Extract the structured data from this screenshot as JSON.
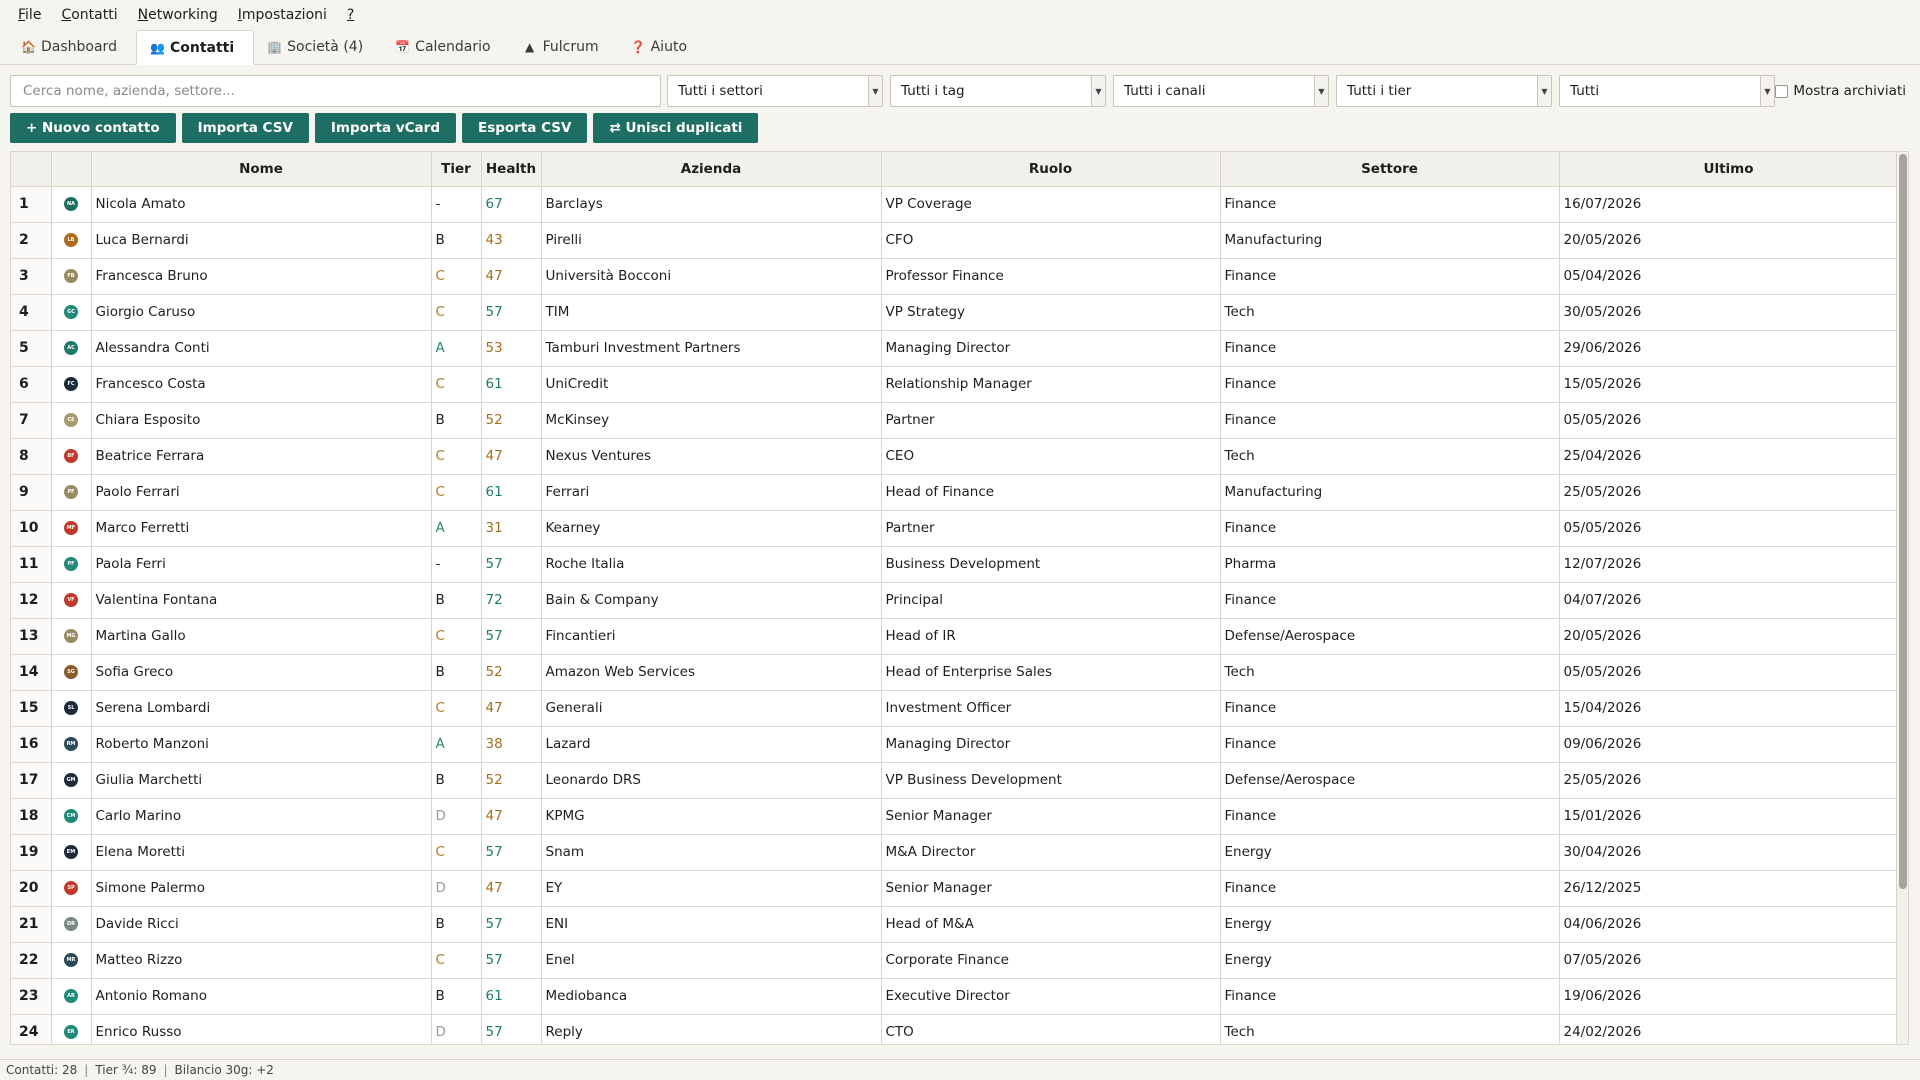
{
  "menu": [
    {
      "u": "F",
      "rest": "ile"
    },
    {
      "u": "C",
      "rest": "ontatti"
    },
    {
      "u": "N",
      "rest": "etworking"
    },
    {
      "u": "I",
      "rest": "mpostazioni"
    },
    {
      "u": "?",
      "rest": ""
    }
  ],
  "tabs": [
    {
      "icon": "🏠",
      "label": "Dashboard",
      "active": false,
      "name": "tab-dashboard"
    },
    {
      "icon": "👥",
      "label": "Contatti",
      "active": true,
      "name": "tab-contatti"
    },
    {
      "icon": "🏢",
      "label": "Società (4)",
      "active": false,
      "name": "tab-societa"
    },
    {
      "icon": "📅",
      "label": "Calendario",
      "active": false,
      "name": "tab-calendario"
    },
    {
      "icon": "▲",
      "label": "Fulcrum",
      "active": false,
      "name": "tab-fulcrum"
    },
    {
      "icon": "❓",
      "label": "Aiuto",
      "active": false,
      "name": "tab-aiuto"
    }
  ],
  "filters": {
    "search_placeholder": "Cerca nome, azienda, settore...",
    "settori": "Tutti i settori",
    "tag": "Tutti i tag",
    "canali": "Tutti i canali",
    "tier": "Tutti i tier",
    "stato": "Tutti",
    "archived_label": "Mostra archiviati"
  },
  "actions": {
    "new": "+ Nuovo contatto",
    "import_csv": "Importa CSV",
    "import_vcard": "Importa vCard",
    "export_csv": "Esporta CSV",
    "merge": "⇄ Unisci duplicati"
  },
  "table": {
    "columns": [
      "",
      "",
      "Nome",
      "Tier",
      "Health",
      "Azienda",
      "Ruolo",
      "Settore",
      "Ultimo"
    ],
    "rows": [
      {
        "n": "1",
        "ini": "NA",
        "color": "#1f6e63",
        "name": "Nicola Amato",
        "tier": "-",
        "health": "67",
        "company": "Barclays",
        "role": "VP Coverage",
        "sector": "Finance",
        "last": "16/07/2026"
      },
      {
        "n": "2",
        "ini": "LB",
        "color": "#b06a1e",
        "name": "Luca Bernardi",
        "tier": "B",
        "health": "43",
        "company": "Pirelli",
        "role": "CFO",
        "sector": "Manufacturing",
        "last": "20/05/2026"
      },
      {
        "n": "3",
        "ini": "FB",
        "color": "#9a8a62",
        "name": "Francesca Bruno",
        "tier": "C",
        "health": "47",
        "company": "Università Bocconi",
        "role": "Professor Finance",
        "sector": "Finance",
        "last": "05/04/2026"
      },
      {
        "n": "4",
        "ini": "GC",
        "color": "#1f8a78",
        "name": "Giorgio Caruso",
        "tier": "C",
        "health": "57",
        "company": "TIM",
        "role": "VP Strategy",
        "sector": "Tech",
        "last": "30/05/2026"
      },
      {
        "n": "5",
        "ini": "AC",
        "color": "#1f7a6c",
        "name": "Alessandra Conti",
        "tier": "A",
        "health": "53",
        "company": "Tamburi Investment Partners",
        "role": "Managing Director",
        "sector": "Finance",
        "last": "29/06/2026"
      },
      {
        "n": "6",
        "ini": "FC",
        "color": "#1c2a3a",
        "name": "Francesco Costa",
        "tier": "C",
        "health": "61",
        "company": "UniCredit",
        "role": "Relationship Manager",
        "sector": "Finance",
        "last": "15/05/2026"
      },
      {
        "n": "7",
        "ini": "CE",
        "color": "#a89a6e",
        "name": "Chiara Esposito",
        "tier": "B",
        "health": "52",
        "company": "McKinsey",
        "role": "Partner",
        "sector": "Finance",
        "last": "05/05/2026"
      },
      {
        "n": "8",
        "ini": "BF",
        "color": "#c0392b",
        "name": "Beatrice Ferrara",
        "tier": "C",
        "health": "47",
        "company": "Nexus Ventures",
        "role": "CEO",
        "sector": "Tech",
        "last": "25/04/2026"
      },
      {
        "n": "9",
        "ini": "PF",
        "color": "#9a8a62",
        "name": "Paolo Ferrari",
        "tier": "C",
        "health": "61",
        "company": "Ferrari",
        "role": "Head of Finance",
        "sector": "Manufacturing",
        "last": "25/05/2026"
      },
      {
        "n": "10",
        "ini": "MF",
        "color": "#c0392b",
        "name": "Marco Ferretti",
        "tier": "A",
        "health": "31",
        "company": "Kearney",
        "role": "Partner",
        "sector": "Finance",
        "last": "05/05/2026"
      },
      {
        "n": "11",
        "ini": "PF",
        "color": "#1f8a78",
        "name": "Paola Ferri",
        "tier": "-",
        "health": "57",
        "company": "Roche Italia",
        "role": "Business Development",
        "sector": "Pharma",
        "last": "12/07/2026"
      },
      {
        "n": "12",
        "ini": "VF",
        "color": "#c0392b",
        "name": "Valentina Fontana",
        "tier": "B",
        "health": "72",
        "company": "Bain & Company",
        "role": "Principal",
        "sector": "Finance",
        "last": "04/07/2026"
      },
      {
        "n": "13",
        "ini": "MG",
        "color": "#9a8a62",
        "name": "Martina Gallo",
        "tier": "C",
        "health": "57",
        "company": "Fincantieri",
        "role": "Head of IR",
        "sector": "Defense/Aerospace",
        "last": "20/05/2026"
      },
      {
        "n": "14",
        "ini": "SG",
        "color": "#8a5a2a",
        "name": "Sofia Greco",
        "tier": "B",
        "health": "52",
        "company": "Amazon Web Services",
        "role": "Head of Enterprise Sales",
        "sector": "Tech",
        "last": "05/05/2026"
      },
      {
        "n": "15",
        "ini": "SL",
        "color": "#1c2a3a",
        "name": "Serena Lombardi",
        "tier": "C",
        "health": "47",
        "company": "Generali",
        "role": "Investment Officer",
        "sector": "Finance",
        "last": "15/04/2026"
      },
      {
        "n": "16",
        "ini": "RM",
        "color": "#2a4a5a",
        "name": "Roberto Manzoni",
        "tier": "A",
        "health": "38",
        "company": "Lazard",
        "role": "Managing Director",
        "sector": "Finance",
        "last": "09/06/2026"
      },
      {
        "n": "17",
        "ini": "GM",
        "color": "#1c2a3a",
        "name": "Giulia Marchetti",
        "tier": "B",
        "health": "52",
        "company": "Leonardo DRS",
        "role": "VP Business Development",
        "sector": "Defense/Aerospace",
        "last": "25/05/2026"
      },
      {
        "n": "18",
        "ini": "CM",
        "color": "#1f8a78",
        "name": "Carlo Marino",
        "tier": "D",
        "health": "47",
        "company": "KPMG",
        "role": "Senior Manager",
        "sector": "Finance",
        "last": "15/01/2026"
      },
      {
        "n": "19",
        "ini": "EM",
        "color": "#1c2a3a",
        "name": "Elena Moretti",
        "tier": "C",
        "health": "57",
        "company": "Snam",
        "role": "M&A Director",
        "sector": "Energy",
        "last": "30/04/2026"
      },
      {
        "n": "20",
        "ini": "SP",
        "color": "#c0392b",
        "name": "Simone Palermo",
        "tier": "D",
        "health": "47",
        "company": "EY",
        "role": "Senior Manager",
        "sector": "Finance",
        "last": "26/12/2025"
      },
      {
        "n": "21",
        "ini": "DR",
        "color": "#7a8a82",
        "name": "Davide Ricci",
        "tier": "B",
        "health": "57",
        "company": "ENI",
        "role": "Head of M&A",
        "sector": "Energy",
        "last": "04/06/2026"
      },
      {
        "n": "22",
        "ini": "MR",
        "color": "#2a4a5a",
        "name": "Matteo Rizzo",
        "tier": "C",
        "health": "57",
        "company": "Enel",
        "role": "Corporate Finance",
        "sector": "Energy",
        "last": "07/05/2026"
      },
      {
        "n": "23",
        "ini": "AR",
        "color": "#1f8a78",
        "name": "Antonio Romano",
        "tier": "B",
        "health": "61",
        "company": "Mediobanca",
        "role": "Executive Director",
        "sector": "Finance",
        "last": "19/06/2026"
      },
      {
        "n": "24",
        "ini": "ER",
        "color": "#1f8a78",
        "name": "Enrico Russo",
        "tier": "D",
        "health": "57",
        "company": "Reply",
        "role": "CTO",
        "sector": "Tech",
        "last": "24/02/2026"
      }
    ]
  },
  "status": {
    "contacts": "Contatti: 28",
    "tier": "Tier ¾: 89",
    "balance": "Bilancio 30g: +2"
  }
}
